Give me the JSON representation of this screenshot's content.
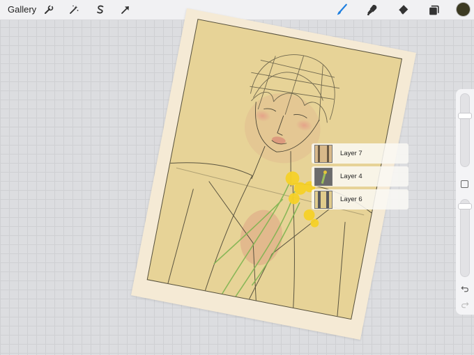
{
  "toolbar": {
    "gallery_label": "Gallery",
    "left_icons": [
      "wrench-icon",
      "magic-wand-icon",
      "selection-s-icon",
      "arrow-transform-icon"
    ],
    "right_icons": [
      "brush-icon",
      "smudge-icon",
      "eraser-icon",
      "layers-icon"
    ],
    "active_tool": "brush",
    "accent_color": "#1e7fe0",
    "current_color": "#3c3a22"
  },
  "layers_popup": {
    "items": [
      {
        "name": "Layer 7"
      },
      {
        "name": "Layer 4"
      },
      {
        "name": "Layer 6"
      }
    ]
  },
  "sidebar": {
    "brush_size_level": 0.72,
    "opacity_level": 0.95
  }
}
